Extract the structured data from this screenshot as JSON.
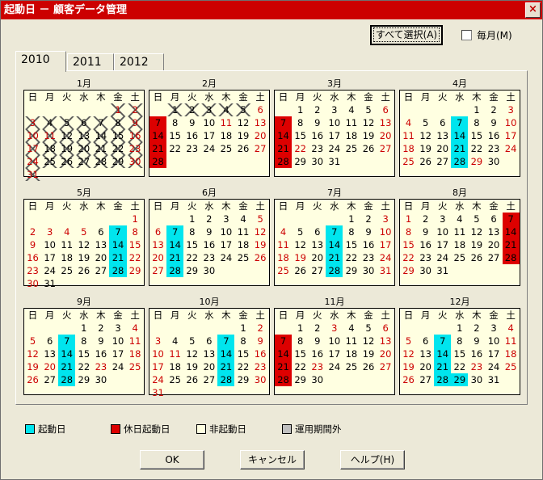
{
  "window": {
    "title": "起動日 － 顧客データ管理",
    "close_label": "×"
  },
  "top": {
    "select_all_label": "すべて選択(A)",
    "monthly_label": "毎月(M)"
  },
  "tabs": [
    "2010",
    "2011",
    "2012"
  ],
  "weekdays": [
    "日",
    "月",
    "火",
    "水",
    "木",
    "金",
    "土"
  ],
  "months": [
    {
      "title": "1月",
      "start": 5,
      "days": 31,
      "crossed": [
        1,
        2,
        3,
        4,
        5,
        6,
        7,
        8,
        9,
        10,
        11,
        12,
        13,
        14,
        15,
        16,
        17,
        18,
        19,
        20,
        21,
        22,
        23,
        24,
        25,
        26,
        27,
        28,
        29,
        30,
        31
      ],
      "red": [
        1,
        2,
        3,
        9,
        10,
        11,
        16,
        17,
        23,
        24,
        30,
        31
      ],
      "cyan": [],
      "holiday": []
    },
    {
      "title": "2月",
      "start": 1,
      "days": 28,
      "crossed": [
        1,
        2,
        3,
        4,
        5
      ],
      "red": [
        6,
        7,
        11,
        13,
        14,
        20,
        21,
        27,
        28
      ],
      "cyan": [],
      "holiday": [
        7,
        14,
        21,
        28
      ]
    },
    {
      "title": "3月",
      "start": 1,
      "days": 31,
      "crossed": [],
      "red": [
        6,
        7,
        13,
        14,
        20,
        21,
        22,
        27,
        28
      ],
      "cyan": [],
      "holiday": [
        7,
        14,
        21,
        28
      ]
    },
    {
      "title": "4月",
      "start": 4,
      "days": 30,
      "crossed": [],
      "red": [
        3,
        4,
        10,
        11,
        17,
        18,
        24,
        25,
        29
      ],
      "cyan": [
        7,
        14,
        21,
        28
      ],
      "holiday": []
    },
    {
      "title": "5月",
      "start": 6,
      "days": 31,
      "crossed": [],
      "red": [
        1,
        2,
        3,
        4,
        5,
        8,
        9,
        15,
        16,
        22,
        23,
        29,
        30
      ],
      "cyan": [
        7,
        14,
        21,
        28
      ],
      "holiday": []
    },
    {
      "title": "6月",
      "start": 2,
      "days": 30,
      "crossed": [],
      "red": [
        5,
        6,
        12,
        13,
        19,
        20,
        26,
        27
      ],
      "cyan": [
        7,
        14,
        21,
        28
      ],
      "holiday": []
    },
    {
      "title": "7月",
      "start": 4,
      "days": 31,
      "crossed": [],
      "red": [
        3,
        4,
        10,
        11,
        17,
        18,
        19,
        24,
        25,
        31
      ],
      "cyan": [
        7,
        14,
        21,
        28
      ],
      "holiday": []
    },
    {
      "title": "8月",
      "start": 0,
      "days": 31,
      "crossed": [],
      "red": [
        1,
        7,
        8,
        14,
        15,
        21,
        22,
        28,
        29
      ],
      "cyan": [],
      "holiday": [
        7,
        14,
        21,
        28
      ]
    },
    {
      "title": "9月",
      "start": 3,
      "days": 30,
      "crossed": [],
      "red": [
        4,
        5,
        11,
        12,
        18,
        19,
        20,
        23,
        25,
        26
      ],
      "cyan": [
        7,
        14,
        21,
        28
      ],
      "holiday": []
    },
    {
      "title": "10月",
      "start": 5,
      "days": 31,
      "crossed": [],
      "red": [
        2,
        3,
        9,
        10,
        11,
        16,
        17,
        23,
        24,
        30,
        31
      ],
      "cyan": [
        7,
        14,
        21,
        28
      ],
      "holiday": []
    },
    {
      "title": "11月",
      "start": 1,
      "days": 30,
      "crossed": [],
      "red": [
        3,
        6,
        7,
        13,
        14,
        20,
        21,
        23,
        27,
        28
      ],
      "cyan": [],
      "holiday": [
        7,
        14,
        21,
        28
      ]
    },
    {
      "title": "12月",
      "start": 3,
      "days": 31,
      "crossed": [],
      "red": [
        4,
        5,
        11,
        12,
        18,
        19,
        23,
        25,
        26
      ],
      "cyan": [
        7,
        14,
        21,
        28,
        29
      ],
      "holiday": []
    }
  ],
  "legend": [
    {
      "label": "起動日",
      "color": "#00e5ee"
    },
    {
      "label": "休日起動日",
      "color": "#dd0000"
    },
    {
      "label": "非起動日",
      "color": "#ffffe1"
    },
    {
      "label": "運用期間外",
      "color": "#c0c0c0"
    }
  ],
  "buttons": {
    "ok_label": "OK",
    "cancel_label": "キャンセル",
    "help_label": "ヘルプ(H)"
  }
}
